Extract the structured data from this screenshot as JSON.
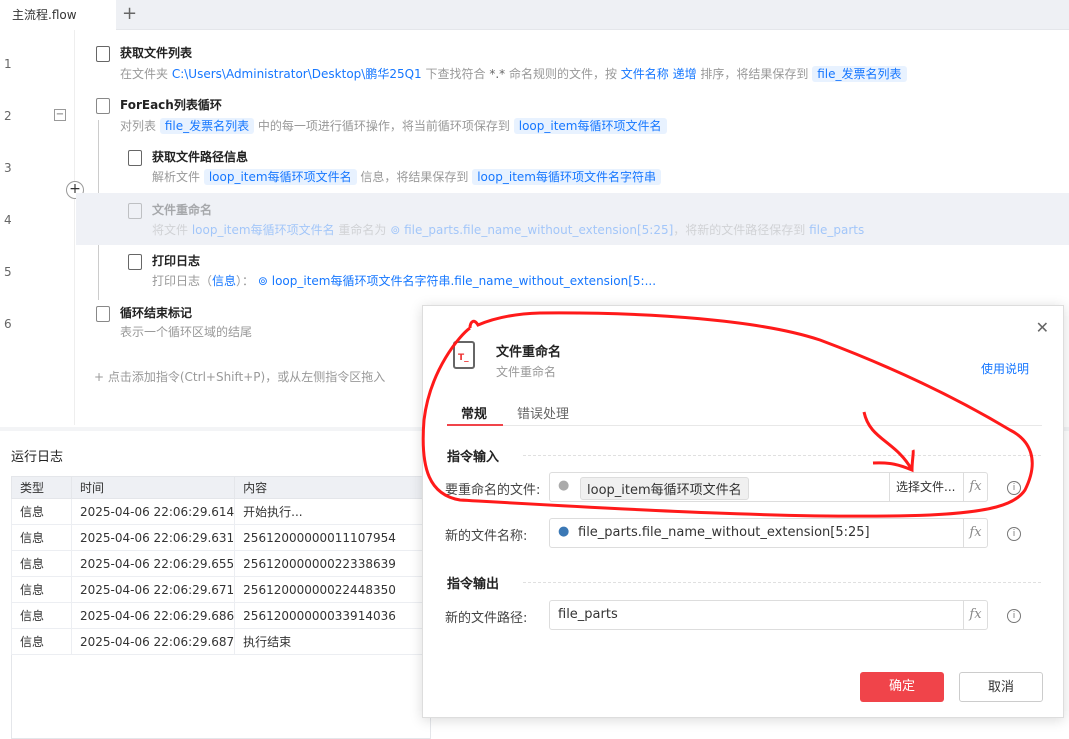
{
  "tabs": {
    "active": "主流程.flow",
    "add": "+"
  },
  "steps": [
    {
      "line": "1",
      "title": "获取文件列表",
      "d1": "在文件夹 ",
      "path": "C:\\Users\\Administrator\\Desktop\\鹏华25Q1",
      "d2": " 下查找符合 ",
      "pattern": "*.*",
      "d3": " 命名规则的文件，按 ",
      "sort": "文件名称 递增",
      "d4": " 排序，将结果保存到 ",
      "out": "file_发票名列表"
    },
    {
      "line": "2",
      "title": "ForEach列表循环",
      "d1": "对列表 ",
      "list": "file_发票名列表",
      "d2": " 中的每一项进行循环操作，将当前循环项保存到 ",
      "out": "loop_item每循环项文件名"
    },
    {
      "line": "3",
      "title": "获取文件路径信息",
      "d1": "解析文件 ",
      "in": "loop_item每循环项文件名",
      "d2": " 信息，将结果保存到 ",
      "out": "loop_item每循环项文件名字符串"
    },
    {
      "line": "4",
      "title": "文件重命名",
      "d1": "将文件 ",
      "in": "loop_item每循环项文件名",
      "d2": " 重命名为 ",
      "expr": "⊚ file_parts.file_name_without_extension[5:25]",
      "d3": "，将新的文件路径保存到 ",
      "out": "file_parts"
    },
    {
      "line": "5",
      "title": "打印日志",
      "d1": "打印日志（",
      "level": "信息",
      "d2": "）： ",
      "expr": "⊚ loop_item每循环项文件名字符串.file_name_without_extension[5:..."
    },
    {
      "line": "6",
      "title": "循环结束标记",
      "d1": "表示一个循环区域的结尾"
    }
  ],
  "add_hint": "+  点击添加指令(Ctrl+Shift+P)，或从左侧指令区拖入",
  "log": {
    "title": "运行日志",
    "columns": [
      "类型",
      "时间",
      "内容"
    ],
    "rows": [
      [
        "信息",
        "2025-04-06 22:06:29.614",
        "开始执行..."
      ],
      [
        "信息",
        "2025-04-06 22:06:29.631",
        "25612000000011107954"
      ],
      [
        "信息",
        "2025-04-06 22:06:29.655",
        "25612000000022338639"
      ],
      [
        "信息",
        "2025-04-06 22:06:29.671",
        "25612000000022448350"
      ],
      [
        "信息",
        "2025-04-06 22:06:29.686",
        "25612000000033914036"
      ],
      [
        "信息",
        "2025-04-06 22:06:29.687",
        "执行结束"
      ]
    ]
  },
  "dialog": {
    "title": "文件重命名",
    "subtitle": "文件重命名",
    "help": "使用说明",
    "tabs": [
      "常规",
      "错误处理"
    ],
    "input_section": "指令输入",
    "output_section": "指令输出",
    "f1_label": "要重命名的文件:",
    "f1_value": "loop_item每循环项文件名",
    "f1_select": "选择文件...",
    "f2_label": "新的文件名称:",
    "f2_value": "file_parts.file_name_without_extension[5:25]",
    "f3_label": "新的文件路径:",
    "f3_value": "file_parts",
    "fx": "fx",
    "info": "i",
    "ok": "确定",
    "cancel": "取消",
    "close": "✕"
  },
  "colors": {
    "accent": "#1677ff",
    "primary_button": "#f0444a",
    "annotation": "#ff0000"
  }
}
